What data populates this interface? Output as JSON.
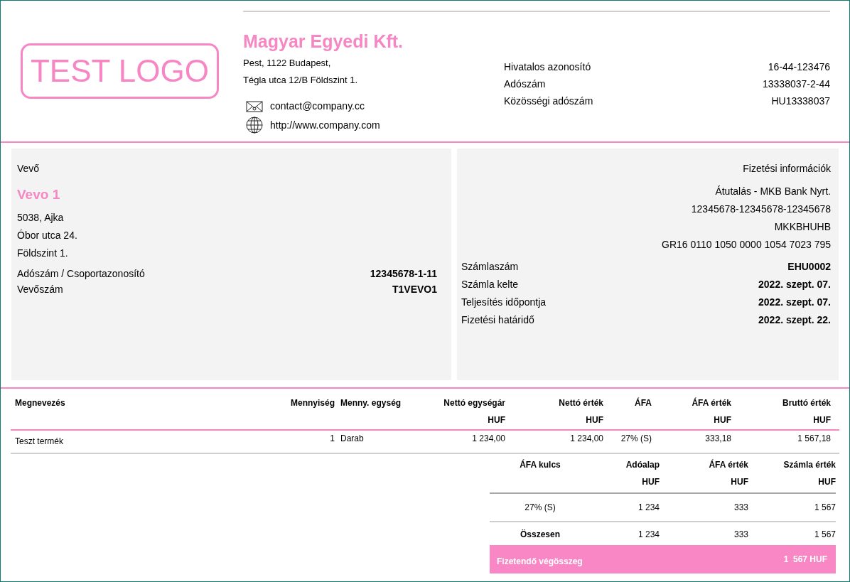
{
  "seller": {
    "logo_text": "TEST LOGO",
    "name": "Magyar Egyedi Kft.",
    "address_lines": [
      "Pest, 1122 Budapest,",
      "Tégla utca 12/B Földszint 1."
    ],
    "email": "contact@company.cc",
    "website": "http://www.company.com",
    "ids": [
      {
        "label": "Hivatalos azonosító",
        "value": "16-44-123476"
      },
      {
        "label": "Adószám",
        "value": "13338037-2-44"
      },
      {
        "label": "Közösségi adószám",
        "value": "HU13338037"
      }
    ]
  },
  "buyer": {
    "heading": "Vevő",
    "name": "Vevo 1",
    "address_lines": [
      "5038, Ajka",
      "Óbor utca 24.",
      "Földszint 1."
    ],
    "fields": [
      {
        "label": "Adószám / Csoportazonosító",
        "value": "12345678-1-11"
      },
      {
        "label": "Vevőszám",
        "value": "T1VEVO1"
      }
    ]
  },
  "payment": {
    "heading": "Fizetési információk",
    "lines": [
      "Átutalás - MKB Bank Nyrt.",
      "12345678-12345678-12345678",
      "MKKBHUHB",
      "GR16 0110 1050 0000 1054 7023 795"
    ],
    "fields": [
      {
        "label": "Számlaszám",
        "value": "EHU0002"
      },
      {
        "label": "Számla kelte",
        "value": "2022. szept. 07."
      },
      {
        "label": "Teljesítés időpontja",
        "value": "2022. szept. 07."
      },
      {
        "label": "Fizetési határidő",
        "value": "2022. szept. 22."
      }
    ]
  },
  "items": {
    "columns": [
      {
        "label": "Megnevezés"
      },
      {
        "label": "Mennyiség"
      },
      {
        "label": "Menny. egység"
      },
      {
        "label": "Nettó egységár",
        "unit": "HUF"
      },
      {
        "label": "Nettó érték",
        "unit": "HUF"
      },
      {
        "label": "ÁFA"
      },
      {
        "label": "ÁFA érték",
        "unit": "HUF"
      },
      {
        "label": "Bruttó érték",
        "unit": "HUF"
      }
    ],
    "rows": [
      {
        "cells": [
          "Teszt termék",
          "1",
          "Darab",
          "1 234,00",
          "1 234,00",
          "27% (S)",
          "333,18",
          "1 567,18"
        ]
      }
    ]
  },
  "summary": {
    "columns": [
      {
        "label": "ÁFA kulcs"
      },
      {
        "label": "Adóalap",
        "unit": "HUF"
      },
      {
        "label": "ÁFA érték",
        "unit": "HUF"
      },
      {
        "label": "Számla érték",
        "unit": "HUF"
      }
    ],
    "rows": [
      {
        "cells": [
          "27% (S)",
          "1 234",
          "333",
          "1 567"
        ]
      }
    ],
    "total": {
      "label": "Összesen",
      "cells": [
        "1 234",
        "333",
        "1 567"
      ]
    },
    "payable": {
      "label": "Fizetendő végösszeg",
      "value": "1  567 HUF"
    }
  }
}
